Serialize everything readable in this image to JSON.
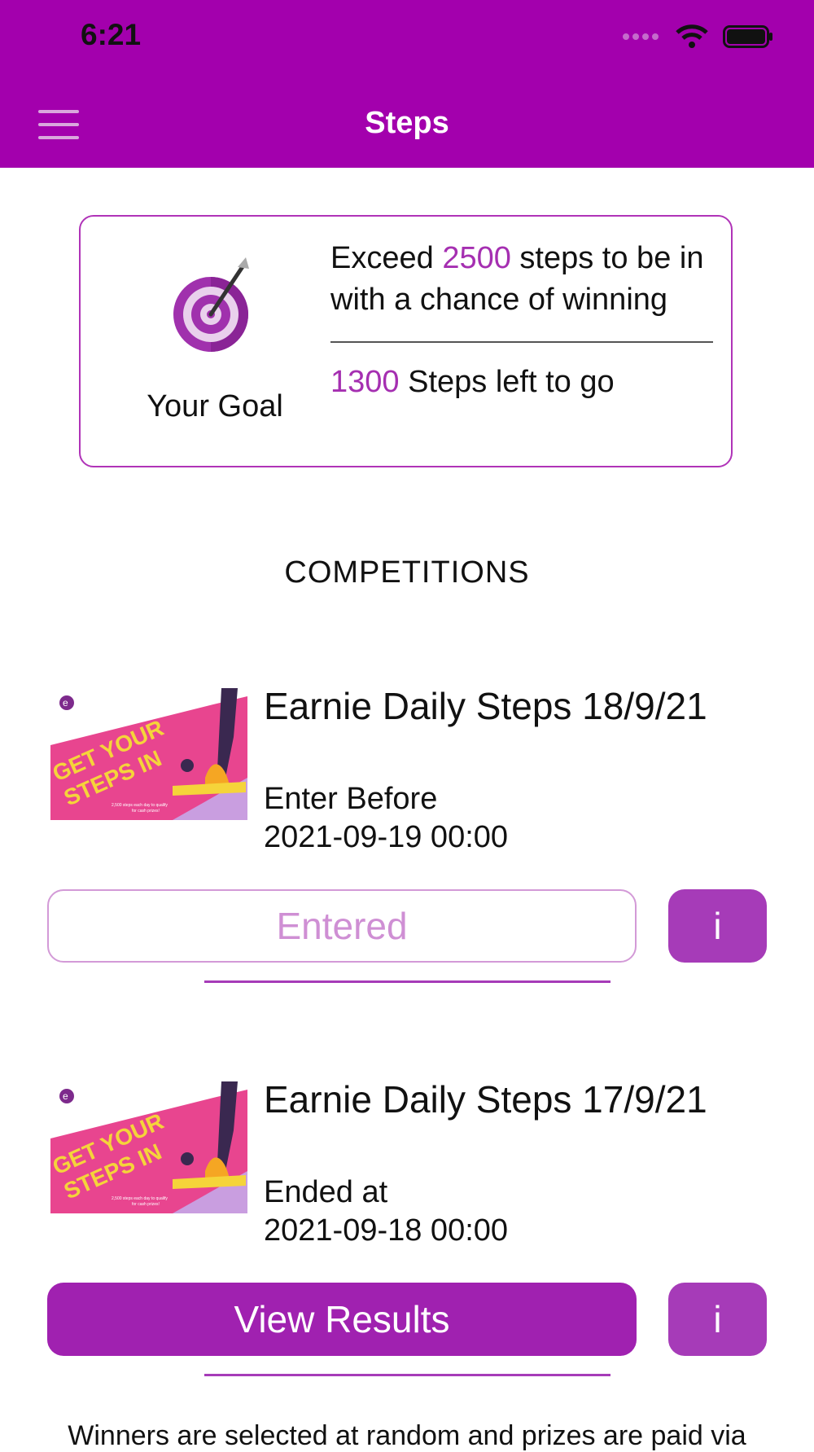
{
  "status_bar": {
    "time": "6:21",
    "icons": [
      "signal-icon",
      "wifi-icon",
      "battery-icon"
    ]
  },
  "nav": {
    "title": "Steps",
    "menu_icon": "hamburger-menu-icon"
  },
  "goal": {
    "label": "Your Goal",
    "text_prefix": "Exceed",
    "goal_steps": "2500",
    "text_suffix": "steps to be in with a chance of winning",
    "steps_left_value": "1300",
    "steps_left_text": "Steps left to go",
    "icon": "target-icon"
  },
  "competitions": {
    "section_title": "COMPETITIONS",
    "items": [
      {
        "title": "Earnie Daily Steps 18/9/21",
        "date_label": "Enter Before",
        "date": "2021-09-19 00:00",
        "action_label": "Entered",
        "info_label": "i",
        "banner": {
          "headline_1": "GET YOUR",
          "headline_2": "STEPS IN",
          "fine_print_1": "2,500 steps each day to qualify",
          "fine_print_2": "for cash prizes!"
        }
      },
      {
        "title": "Earnie Daily Steps 17/9/21",
        "date_label": "Ended at",
        "date": "2021-09-18 00:00",
        "action_label": "View Results",
        "info_label": "i",
        "banner": {
          "headline_1": "GET YOUR",
          "headline_2": "STEPS IN",
          "fine_print_1": "2,500 steps each day to qualify",
          "fine_print_2": "for cash prizes!"
        }
      }
    ]
  },
  "footer": {
    "text": "Winners are selected at random and prizes are paid via"
  },
  "colors": {
    "brand_purple": "#a300ad",
    "accent_purple": "#a52fb1",
    "button_purple": "#a021b0"
  }
}
